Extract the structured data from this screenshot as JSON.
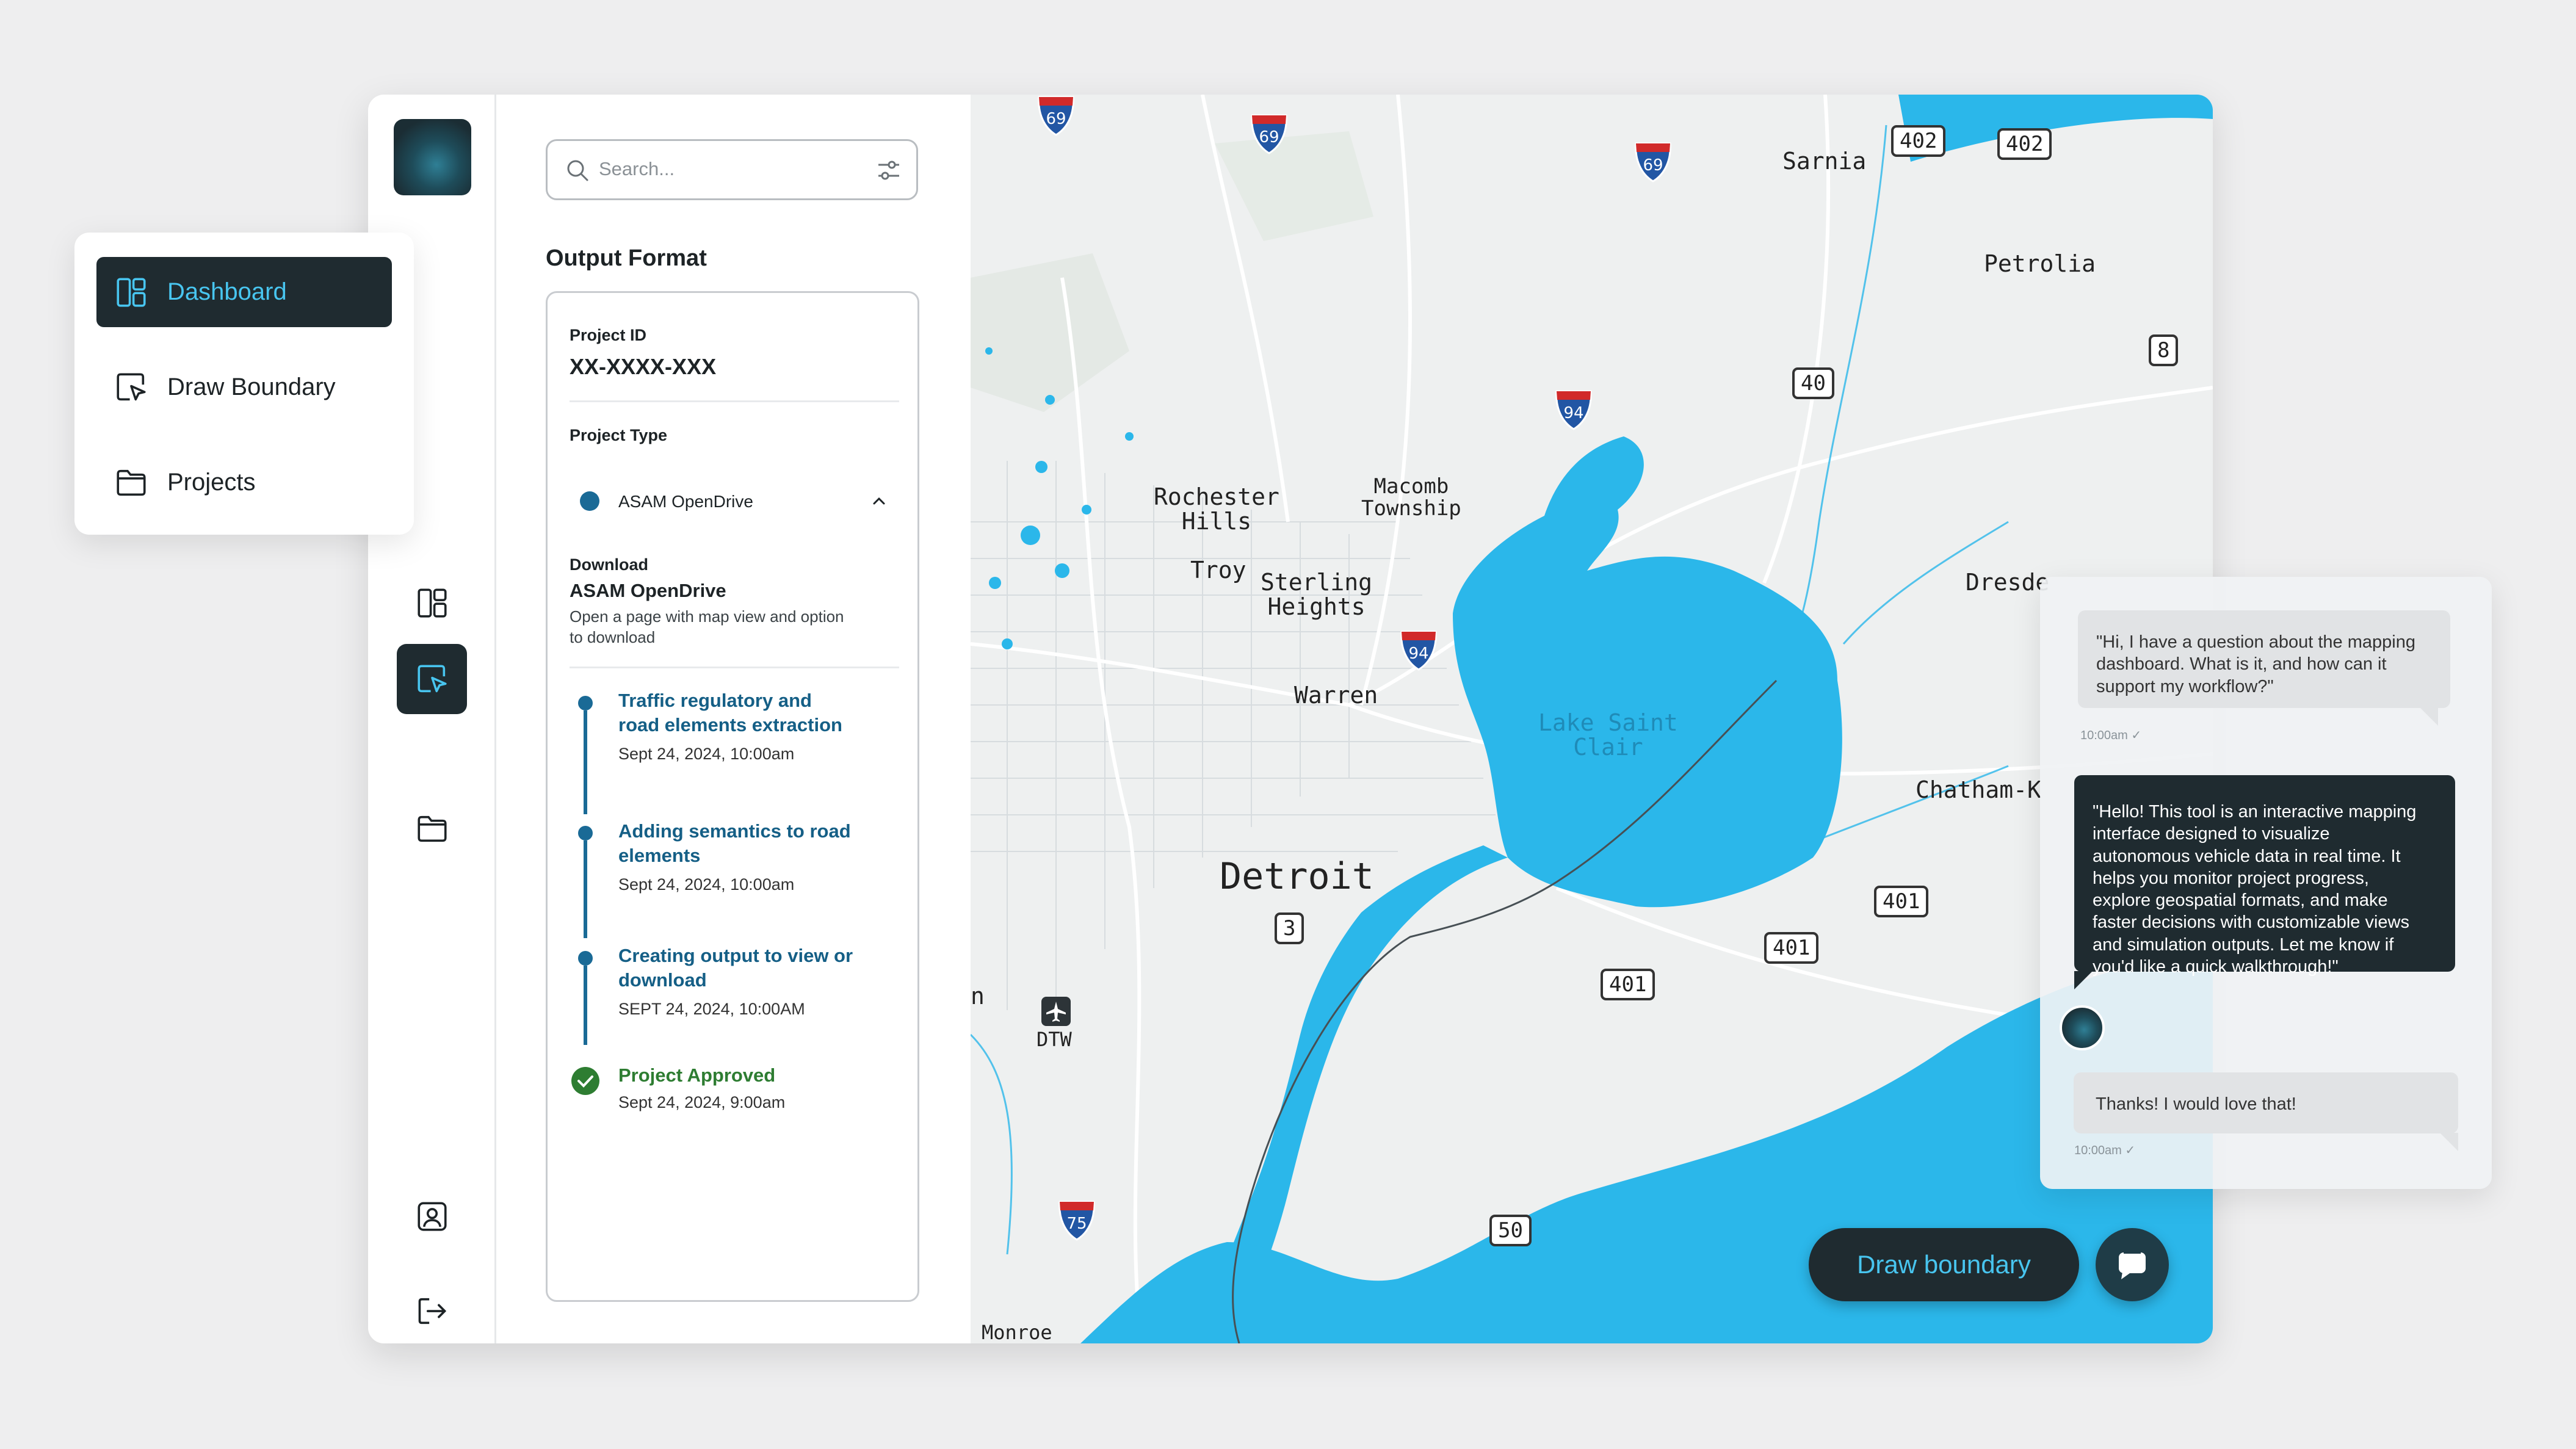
{
  "nav": {
    "items": [
      {
        "label": "Dashboard",
        "icon": "dashboard-icon",
        "active": true
      },
      {
        "label": "Draw Boundary",
        "icon": "draw-boundary-icon",
        "active": false
      },
      {
        "label": "Projects",
        "icon": "folder-icon",
        "active": false
      }
    ]
  },
  "rail": {
    "icons": [
      "dashboard-icon",
      "draw-boundary-icon",
      "folder-icon",
      "profile-icon",
      "logout-icon"
    ],
    "active": "draw-boundary-icon"
  },
  "search": {
    "placeholder": "Search..."
  },
  "panel": {
    "title": "Output Format",
    "project_id_label": "Project ID",
    "project_id": "XX-XXXX-XXX",
    "project_type_label": "Project Type",
    "project_type_value": "ASAM OpenDrive",
    "download_label": "Download",
    "download_title": "ASAM OpenDrive",
    "download_desc_1": "Open a page with map view and option",
    "download_desc_2": "to download",
    "timeline": [
      {
        "title_1": "Traffic regulatory and",
        "title_2": "road elements extraction",
        "date": "Sept 24, 2024, 10:00am"
      },
      {
        "title_1": "Adding semantics to road",
        "title_2": "elements",
        "date": "Sept 24, 2024, 10:00am"
      },
      {
        "title_1": "Creating output to view or",
        "title_2": "download",
        "date": "SEPT 24, 2024, 10:00AM"
      },
      {
        "title_1": "Project Approved",
        "title_2": "",
        "date": "Sept 24, 2024, 9:00am"
      }
    ]
  },
  "map": {
    "labels": {
      "sarnia": "Sarnia",
      "petrolia": "Petrolia",
      "rochester": "Rochester\nHills",
      "macomb": "Macomb\nTownship",
      "troy": "Troy",
      "sterling": "Sterling\nHeights",
      "dresden": "Dresde",
      "warren": "Warren",
      "lake": "Lake Saint\nClair",
      "chatham": "Chatham-K",
      "detroit": "Detroit",
      "dtw": "DTW",
      "monroe": "Monroe",
      "edge_n": "n"
    },
    "shields": {
      "h402a": "402",
      "h402b": "402",
      "h8": "8",
      "h40": "40",
      "h401a": "401",
      "h401b": "401",
      "h401c": "401",
      "h3": "3",
      "h50": "50",
      "i69a": "69",
      "i69b": "69",
      "i69c": "69",
      "i94a": "94",
      "i94b": "94",
      "i75": "75"
    },
    "colors": {
      "water": "#2bb7ea",
      "land": "#eef0f0",
      "road": "#ffffff"
    }
  },
  "chat": {
    "messages": [
      {
        "from": "user",
        "lines": [
          "\"Hi, I have a question about the mapping",
          "dashboard. What is it, and how can it",
          "support my workflow?\""
        ],
        "time": "10:00am ✓"
      },
      {
        "from": "bot",
        "lines": [
          "\"Hello! This tool is an interactive mapping",
          "interface designed to visualize",
          "autonomous vehicle data in real time. It",
          "helps you monitor project progress,",
          "explore geospatial formats, and make",
          "faster decisions with customizable views",
          "and simulation outputs. Let me know if",
          "you'd like a quick walkthrough!\""
        ]
      },
      {
        "from": "user",
        "lines": [
          "Thanks! I would love that!"
        ],
        "time": "10:00am ✓"
      }
    ]
  },
  "actions": {
    "draw_boundary": "Draw boundary"
  },
  "colors": {
    "accent": "#48c5ef",
    "dark": "#1f2b30",
    "timeline": "#1a6a96",
    "approved": "#2e7d32"
  }
}
